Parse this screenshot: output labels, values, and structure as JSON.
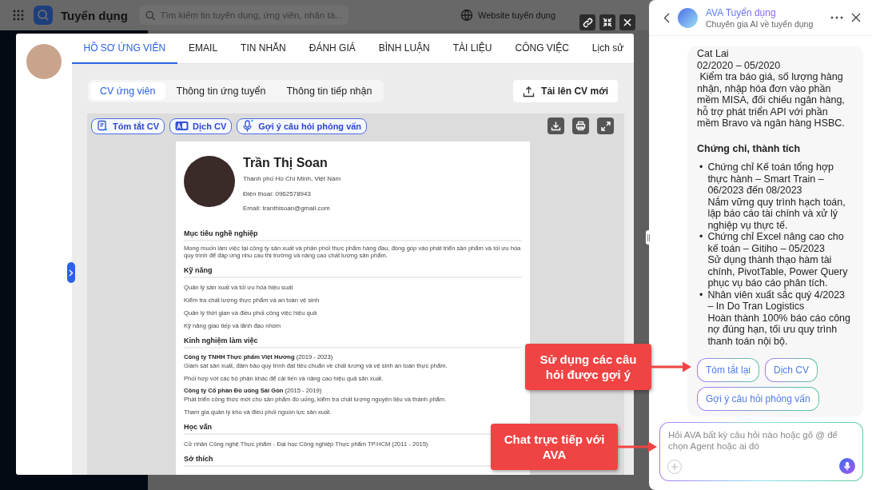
{
  "app_bar": {
    "title": "Tuyển dụng",
    "search": {
      "placeholder": "Tìm kiếm tin tuyển dụng, ứng viên, nhân tà..."
    },
    "website_link": "Website tuyển dụng"
  },
  "candidate_modal": {
    "tabs": [
      {
        "label": "HỒ SƠ ỨNG VIÊN",
        "selected": true
      },
      {
        "label": "EMAIL",
        "selected": false
      },
      {
        "label": "TIN NHẮN",
        "selected": false
      },
      {
        "label": "ĐÁNH GIÁ",
        "selected": false
      },
      {
        "label": "BÌNH LUẬN",
        "selected": false
      },
      {
        "label": "TÀI LIỆU",
        "selected": false
      },
      {
        "label": "CÔNG VIỆC",
        "selected": false
      },
      {
        "label": "Lịch sử",
        "selected": false
      }
    ],
    "view_tabs": [
      {
        "label": "CV ứng viên",
        "selected": true
      },
      {
        "label": "Thông tin ứng tuyển",
        "selected": false
      },
      {
        "label": "Thông tin tiếp nhận",
        "selected": false
      }
    ],
    "upload_button": "Tải lên CV mới",
    "ai_actions": [
      {
        "kind": "summary",
        "label": "Tóm tắt CV"
      },
      {
        "kind": "translate",
        "label": "Dịch CV"
      },
      {
        "kind": "questions",
        "label": "Gợi ý câu hỏi phỏng vấn"
      }
    ],
    "cv": {
      "name": "Trần Thị Soan",
      "contact": [
        "Thành phố Hồ Chí Minh, Việt Nam",
        "Điện thoại: 0962578943",
        "Email: tranthisoan@gmail.com"
      ],
      "sections": [
        {
          "title": "Mục tiêu nghề nghiệp",
          "items": [
            {
              "kind": "paragraph",
              "text": "Mong muốn làm việc tại công ty sản xuất và phân phối thực phẩm hàng đầu, đóng góp vào phát triển sản phẩm và tối ưu hóa quy trình để đáp ứng nhu cầu thị trường và nâng cao chất lượng sản phẩm."
            }
          ]
        },
        {
          "title": "Kỹ năng",
          "items": [
            {
              "kind": "line",
              "text": "Quản lý sản xuất và tối ưu hóa hiệu suất"
            },
            {
              "kind": "line",
              "text": "Kiểm tra chất lượng thực phẩm và an toàn vệ sinh"
            },
            {
              "kind": "line",
              "text": "Quản lý thời gian và điều phối công việc hiệu quả"
            },
            {
              "kind": "line",
              "text": "Kỹ năng giao tiếp và lãnh đạo nhóm"
            }
          ]
        },
        {
          "title": "Kinh nghiệm làm việc",
          "items": [
            {
              "kind": "company",
              "text": "**Công ty TNHH Thực phẩm Việt Hương** (2019 - 2023)"
            },
            {
              "kind": "line",
              "text": "Giám sát sản xuất, đảm bảo quy trình đạt tiêu chuẩn về chất lượng và vệ sinh an toàn thực phẩm."
            },
            {
              "kind": "line",
              "text": "Phối hợp với các bộ phận khác để cải tiến và nâng cao hiệu quả sản xuất."
            },
            {
              "kind": "company",
              "text": "**Công ty Cổ phần Đồ uống Sài Gòn** (2015 - 2019)"
            },
            {
              "kind": "line",
              "text": "Phát triển công thức mới cho sản phẩm đồ uống, kiểm tra chất lượng nguyên liệu và thành phẩm."
            },
            {
              "kind": "line",
              "text": "Tham gia quản lý kho và điều phối nguồn lực sản xuất."
            }
          ]
        },
        {
          "title": "Học vấn",
          "items": [
            {
              "kind": "line",
              "text": "Cử nhân Công nghệ Thực phẩm - Đại học Công nghiệp Thực phẩm TP.HCM (2011 - 2015)"
            }
          ]
        },
        {
          "title": "Sở thích"
        }
      ]
    }
  },
  "ava_panel": {
    "title": "AVA Tuyển dụng",
    "subtitle": "Chuyên gia AI về tuyển dụng",
    "message": {
      "lines": [
        "Cat Lai",
        "02/2020 – 05/2020"
      ],
      "detail": "Kiểm tra báo giá, số lượng hàng nhận, nhập hóa đơn vào phần mềm MISA, đối chiếu ngân hàng, hỗ trợ phát triển API với phần mềm Bravo và ngân hàng HSBC.",
      "section_title": "Chứng chỉ, thành tích",
      "items": [
        {
          "marker": "•",
          "title": "Chứng chỉ Kế toán tổng hợp thực hành – Smart Train – 06/2023 đến 08/2023",
          "detail": "Nắm vững quy trình hạch toán, lập báo cáo tài chính và xử lý nghiệp vụ thực tế."
        },
        {
          "marker": "•",
          "title": "Chứng chỉ Excel nâng cao cho kế toán – Gitiho – 05/2023",
          "detail": "Sử dụng thành thạo hàm tài chính, PivotTable, Power Query phục vụ báo cáo phân tích."
        },
        {
          "marker": "•",
          "title": "Nhân viên xuất sắc quý 4/2023 – In Do Tran Logistics",
          "detail": "Hoàn thành 100% báo cáo công nợ đúng hạn, tối ưu quy trình thanh toán nội bộ."
        }
      ],
      "suggestions": [
        "Tóm tắt lại",
        "Dịch CV",
        "Gợi ý câu hỏi phỏng vấn"
      ]
    },
    "input": {
      "placeholder": "Hỏi AVA bất kỳ câu hỏi nào hoặc gõ @ để chọn Agent hoặc ai đó"
    }
  },
  "callouts": [
    {
      "text": "Sử dụng các câu hỏi được gợi ý"
    },
    {
      "text": "Chat trực tiếp với AVA"
    }
  ]
}
